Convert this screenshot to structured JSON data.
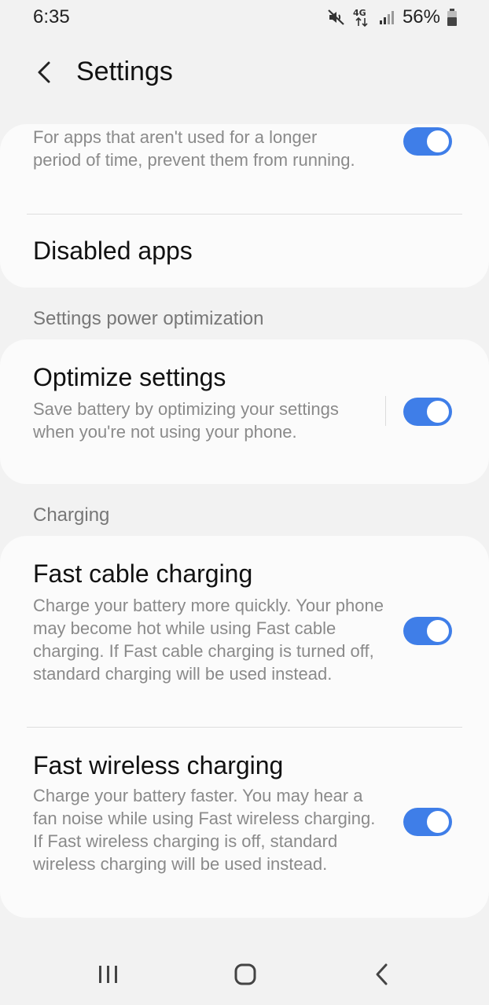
{
  "status_bar": {
    "time": "6:35",
    "network_label": "4G",
    "battery_percent": "56%",
    "icons": [
      "mute-icon",
      "network-4g-icon",
      "signal-icon",
      "battery-icon"
    ]
  },
  "header": {
    "back_icon": "back-arrow-icon",
    "title": "Settings"
  },
  "cards": {
    "sleeping_apps": {
      "description": "For apps that aren't used for a longer period of time, prevent them from running.",
      "toggle_on": true
    },
    "disabled_apps": {
      "title": "Disabled apps"
    }
  },
  "sections": {
    "power_optimization": {
      "header": "Settings power optimization",
      "optimize_settings": {
        "title": "Optimize settings",
        "description": "Save battery by optimizing your settings when you're not using your phone.",
        "toggle_on": true
      }
    },
    "charging": {
      "header": "Charging",
      "fast_cable": {
        "title": "Fast cable charging",
        "description": "Charge your battery more quickly. Your phone may become hot while using Fast cable charging. If Fast cable charging is turned off, standard charging will be used instead.",
        "toggle_on": true
      },
      "fast_wireless": {
        "title": "Fast wireless charging",
        "description": "Charge your battery faster. You may hear a fan noise while using Fast wireless charging. If Fast wireless charging is off, standard wireless charging will be used instead.",
        "toggle_on": true
      }
    }
  },
  "nav_bar": {
    "icons": [
      "recent-apps-icon",
      "home-icon",
      "back-icon"
    ]
  },
  "colors": {
    "accent": "#3f7ee8",
    "background": "#f2f2f2",
    "card": "#fbfbfb",
    "secondary_text": "#8a8a8a"
  }
}
